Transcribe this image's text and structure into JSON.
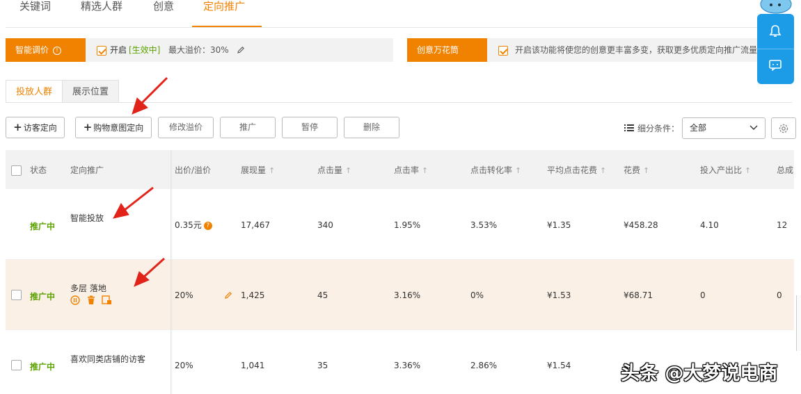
{
  "top_tabs": [
    "关键词",
    "精选人群",
    "创意",
    "定向推广"
  ],
  "smart_bid": {
    "label": "智能调价",
    "enable": "开启",
    "state": "[生效中]",
    "max_premium": "最大溢价：30%"
  },
  "creative": {
    "label": "创意万花筒",
    "text": "开启该功能将使您的创意更丰富多变，获取更多优质定向推广流量"
  },
  "sub_tabs": [
    "投放人群",
    "展示位置"
  ],
  "toolbar": {
    "buttons": [
      "访客定向",
      "购物意图定向",
      "修改溢价",
      "推广",
      "暂停",
      "删除"
    ],
    "filter_label": "细分条件：",
    "filter_value": "全部"
  },
  "table": {
    "headers": [
      "状态",
      "定向推广",
      "出价/溢价",
      "展现量",
      "点击量",
      "点击率",
      "点击转化率",
      "平均点击花费",
      "花费",
      "投入产出比",
      "总成"
    ],
    "rows": [
      {
        "status": "推广中",
        "name": "智能投放",
        "bid": "0.35元",
        "impressions": "17,467",
        "clicks": "340",
        "ctr": "1.95%",
        "cvr": "3.53%",
        "cpc": "¥1.35",
        "cost": "¥458.28",
        "roi": "4.10",
        "total": "12"
      },
      {
        "status": "推广中",
        "name": "多层 落地",
        "bid": "20%",
        "impressions": "1,425",
        "clicks": "45",
        "ctr": "3.16%",
        "cvr": "0%",
        "cpc": "¥1.53",
        "cost": "¥68.71",
        "roi": "0",
        "total": "0"
      },
      {
        "status": "推广中",
        "name": "喜欢同类店铺的访客",
        "bid": "20%",
        "impressions": "1,041",
        "clicks": "35",
        "ctr": "3.36%",
        "cvr": "2.86%",
        "cpc": "¥1.54",
        "cost": "",
        "roi": "",
        "total": ""
      }
    ]
  },
  "watermark": "头条 @大梦说电商",
  "colors": {
    "accent": "#f08200",
    "status": "#5ba100",
    "float": "#1c9be6",
    "arrow": "#e2231a",
    "highlight_row": "#faf0e6"
  }
}
